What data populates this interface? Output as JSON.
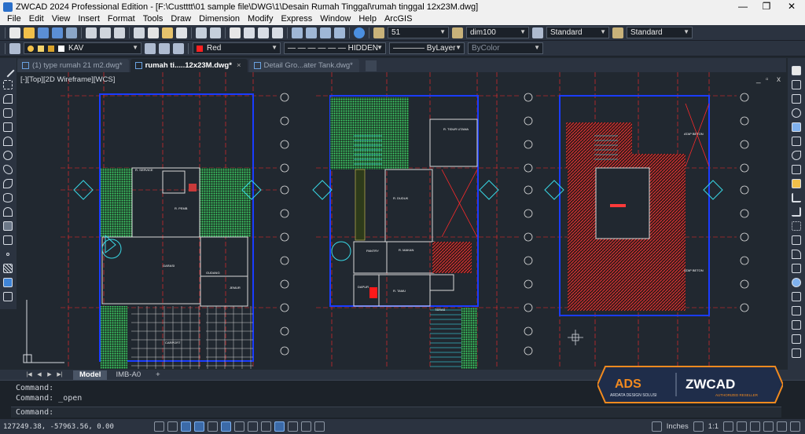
{
  "window": {
    "title": "ZWCAD 2024 Professional Edition - [F:\\Custttt\\01 sample file\\DWG\\1\\Desain Rumah Tinggal\\rumah tinggal 12x23M.dwg]",
    "minimize": "—",
    "restore": "❐",
    "close": "✕"
  },
  "menu": [
    "File",
    "Edit",
    "View",
    "Insert",
    "Format",
    "Tools",
    "Draw",
    "Dimension",
    "Modify",
    "Express",
    "Window",
    "Help",
    "ArcGIS"
  ],
  "toolbar": {
    "text_style": "51",
    "dim_style": "dim100",
    "table_style": "Standard",
    "multileader_style": "Standard",
    "layer": "KAV",
    "color": "Red",
    "color_hex": "#ff2020",
    "linetype": "— — — — — — HIDDEN",
    "lineweight": "———— ByLayer",
    "plot_style": "ByColor"
  },
  "doc_tabs": [
    {
      "label": "(1) type rumah 21 m2.dwg*",
      "active": false
    },
    {
      "label": "rumah ti.....12x23M.dwg*",
      "active": true
    },
    {
      "label": "Detail Gro...ater Tank.dwg*",
      "active": false
    }
  ],
  "viewport": {
    "label": "[-][Top][2D Wireframe][WCS]",
    "minimize": "_",
    "restore": "▫",
    "close": "x"
  },
  "drawing_text": {
    "plan1": [
      "R. SERVICE",
      "R. PEMB",
      "GARASI",
      "GUDANG",
      "JEMUR",
      "CARPORT"
    ],
    "plan2": [
      "R. TIDUR UTAMA",
      "R. DUDUK",
      "PANTRY",
      "R. MAKAN",
      "DAPUR",
      "R. TAMU",
      "TERAS"
    ],
    "plan3": [
      "ATAP BETON",
      "ATAP BETON"
    ]
  },
  "layout_tabs": [
    "Model",
    "IMB-A0",
    "+"
  ],
  "command_history": [
    "Command:",
    "Command: _open"
  ],
  "command_prompt": "Command:",
  "status": {
    "coords": "127249.38, -57963.56, 0.00",
    "units": "Inches",
    "scale": "1:1"
  },
  "watermark": {
    "brand_left": "ADS",
    "brand_left_sub": "ARDATA DESIGN SOLUSI",
    "brand_right": "ZWCAD",
    "brand_right_sub": "AUTHORIZED RESELLER"
  },
  "colors": {
    "titlebar_bg": "#f0f0f0",
    "toolbar_bg": "#2b3340",
    "canvas_bg": "#212830",
    "wall_blue": "#1a3cff",
    "grid_red": "#ff2a2a",
    "hatch_green": "#39c860",
    "cyan": "#39d9e6",
    "ads_orange": "#f28a1f"
  }
}
